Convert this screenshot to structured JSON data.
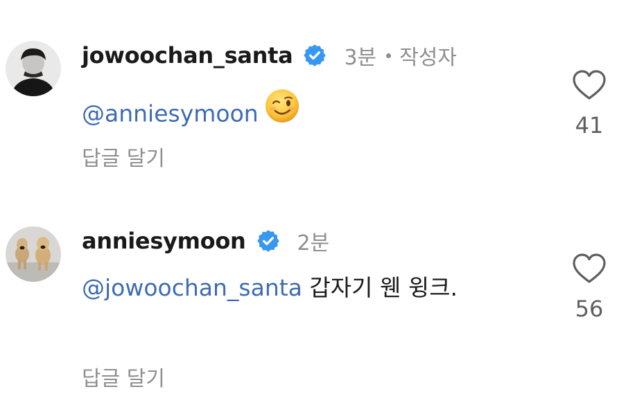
{
  "comments": [
    {
      "username": "jowoochan_santa",
      "time": "3분",
      "author_label": "작성자",
      "mention": "@anniesymoon",
      "text": "",
      "emoji": "winking-face",
      "reply_label": "답글 달기",
      "likes": "41",
      "verified": true,
      "avatar": "person-photo"
    },
    {
      "username": "anniesymoon",
      "time": "2분",
      "mention": "@jowoochan_santa",
      "text": " 갑자기 웬 윙크.",
      "reply_label": "답글 달기",
      "likes": "56",
      "verified": true,
      "avatar": "dogs-photo"
    }
  ],
  "colors": {
    "mention": "#3d6bb3",
    "verified": "#3897f0",
    "muted": "#8e8e8e"
  }
}
